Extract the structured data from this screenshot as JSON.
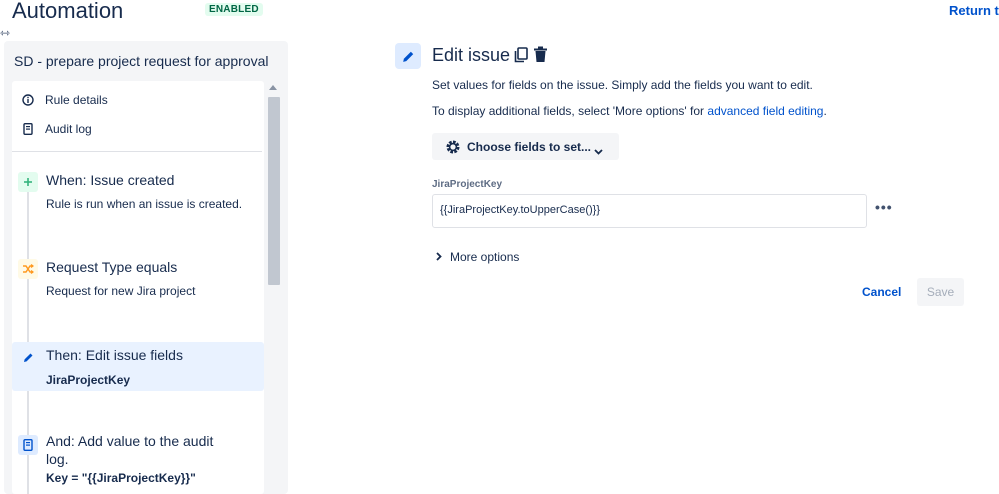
{
  "header": {
    "title": "Automation",
    "status": "ENABLED",
    "return_link": "Return to"
  },
  "sidebar": {
    "rule_name": "SD - prepare project request for approval",
    "meta": [
      {
        "label": "Rule details",
        "icon": "info-icon"
      },
      {
        "label": "Audit log",
        "icon": "audit-log-icon"
      }
    ],
    "steps": [
      {
        "title": "When: Issue created",
        "desc": "Rule is run when an issue is created.",
        "icon": "plus-icon",
        "color": "#36b37e",
        "bg": "#e3fcef"
      },
      {
        "title": "Request Type equals",
        "desc": "Request for new Jira project",
        "icon": "shuffle-icon",
        "color": "#ff991f",
        "bg": "#fffae6"
      },
      {
        "title": "Then: Edit issue fields",
        "desc": "JiraProjectKey",
        "icon": "pencil-icon",
        "color": "#0052cc",
        "bg": "#e9f2ff"
      },
      {
        "title_line1": "And: Add value to the audit",
        "title_line2": "log.",
        "desc": "Key = \"{{JiraProjectKey}}\"",
        "icon": "audit-log-icon",
        "color": "#0052cc",
        "bg": "#deebff"
      }
    ]
  },
  "editor": {
    "title": "Edit issue",
    "desc1": "Set values for fields on the issue. Simply add the fields you want to edit.",
    "desc2_prefix": "To display additional fields, select 'More options' for ",
    "desc2_link": "advanced field editing",
    "desc2_suffix": ".",
    "choose_button": "Choose fields to set...",
    "field_label": "JiraProjectKey",
    "field_value": "{{JiraProjectKey.toUpperCase()}}",
    "more_options": "More options",
    "cancel": "Cancel",
    "save": "Save"
  },
  "colors": {
    "accent": "#0052cc",
    "enabled_badge": "#006644"
  }
}
